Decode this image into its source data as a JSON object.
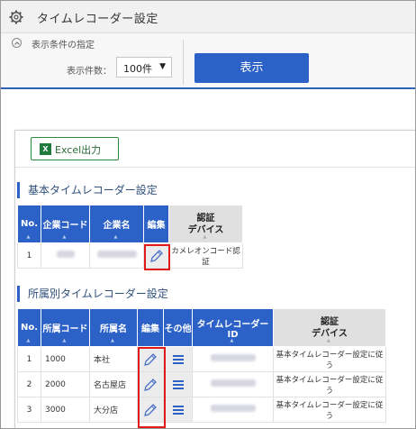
{
  "window": {
    "title": "タイムレコーダー設定"
  },
  "icons": {
    "gear": "gear-icon",
    "collapse": "chevron-up-icon",
    "excel": "excel-icon",
    "edit": "pencil-icon",
    "other": "menu-icon",
    "sort": "sort-triangle-icon"
  },
  "colors": {
    "accent": "#2c61c8",
    "header_bar": "#2c61b3",
    "excel_green": "#1f7a3e",
    "highlight": "#e21919"
  },
  "filter": {
    "section_label": "表示条件の指定",
    "count_label": "表示件数：",
    "count_value": "100件",
    "show_button": "表示"
  },
  "excel_button": {
    "label": "Excel出力"
  },
  "basic_section": {
    "title": "基本タイムレコーダー設定",
    "headers": {
      "no": "No.",
      "company_code": "企業コード",
      "company_name": "企業名",
      "edit": "編集",
      "auth_device": "認証\nデバイス"
    },
    "rows": [
      {
        "no": "1",
        "auth_device": "カメレオンコード認証"
      }
    ]
  },
  "dept_section": {
    "title": "所属別タイムレコーダー設定",
    "headers": {
      "no": "No.",
      "dept_code": "所属コード",
      "dept_name": "所属名",
      "edit": "編集",
      "other": "その他",
      "recorder_id": "タイムレコーダーID",
      "auth_device": "認証\nデバイス"
    },
    "rows": [
      {
        "no": "1",
        "code": "1000",
        "name": "本社",
        "auth_device": "基本タイムレコーダー設定に従う"
      },
      {
        "no": "2",
        "code": "2000",
        "name": "名古屋店",
        "auth_device": "基本タイムレコーダー設定に従う"
      },
      {
        "no": "3",
        "code": "3000",
        "name": "大分店",
        "auth_device": "基本タイムレコーダー設定に従う"
      }
    ]
  }
}
